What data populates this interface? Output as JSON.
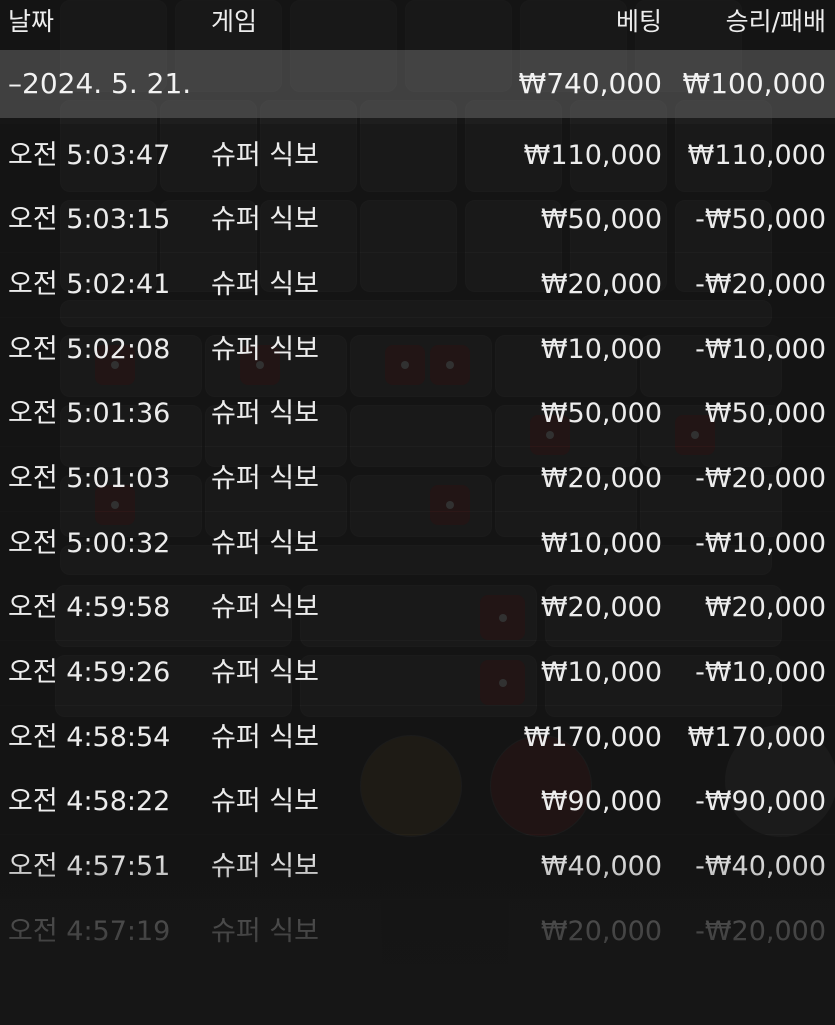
{
  "header": {
    "date_label": "날짜",
    "game_label": "게임",
    "bet_label": "베팅",
    "result_label": "승리/패배"
  },
  "group": {
    "date": "–2024. 5. 21.",
    "bet_total": "₩740,000",
    "result_total": "₩100,000"
  },
  "rows": [
    {
      "time": "오전 5:03:47",
      "game": "슈퍼 식보",
      "bet": "₩110,000",
      "result": "₩110,000"
    },
    {
      "time": "오전 5:03:15",
      "game": "슈퍼 식보",
      "bet": "₩50,000",
      "result": "-₩50,000"
    },
    {
      "time": "오전 5:02:41",
      "game": "슈퍼 식보",
      "bet": "₩20,000",
      "result": "-₩20,000"
    },
    {
      "time": "오전 5:02:08",
      "game": "슈퍼 식보",
      "bet": "₩10,000",
      "result": "-₩10,000"
    },
    {
      "time": "오전 5:01:36",
      "game": "슈퍼 식보",
      "bet": "₩50,000",
      "result": "₩50,000"
    },
    {
      "time": "오전 5:01:03",
      "game": "슈퍼 식보",
      "bet": "₩20,000",
      "result": "-₩20,000"
    },
    {
      "time": "오전 5:00:32",
      "game": "슈퍼 식보",
      "bet": "₩10,000",
      "result": "-₩10,000"
    },
    {
      "time": "오전 4:59:58",
      "game": "슈퍼 식보",
      "bet": "₩20,000",
      "result": "₩20,000"
    },
    {
      "time": "오전 4:59:26",
      "game": "슈퍼 식보",
      "bet": "₩10,000",
      "result": "-₩10,000"
    },
    {
      "time": "오전 4:58:54",
      "game": "슈퍼 식보",
      "bet": "₩170,000",
      "result": "₩170,000"
    },
    {
      "time": "오전 4:58:22",
      "game": "슈퍼 식보",
      "bet": "₩90,000",
      "result": "-₩90,000"
    },
    {
      "time": "오전 4:57:51",
      "game": "슈퍼 식보",
      "bet": "₩40,000",
      "result": "-₩40,000"
    },
    {
      "time": "오전 4:57:19",
      "game": "슈퍼 식보",
      "bet": "₩20,000",
      "result": "-₩20,000"
    }
  ]
}
